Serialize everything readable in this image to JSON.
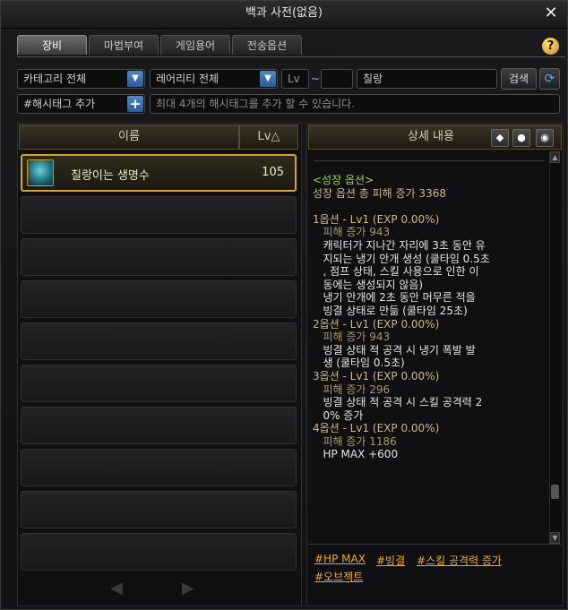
{
  "window": {
    "title": "백과 사전(없음)"
  },
  "tabs": [
    {
      "label": "장비",
      "active": true
    },
    {
      "label": "마법부여",
      "active": false
    },
    {
      "label": "게임용어",
      "active": false
    },
    {
      "label": "전송옵션",
      "active": false
    }
  ],
  "filters": {
    "category": "카테고리 전체",
    "rarity": "레어리티 전체",
    "lv_label": "Lv",
    "lv_sep": "~",
    "lv_from": "",
    "lv_to": "",
    "search_value": "칠랑",
    "search_button": "검색",
    "hashtag_button": "#해시태그 추가",
    "hashtag_placeholder": "최대 4개의 해시태그를 추가 할 수 있습니다."
  },
  "list": {
    "header_name": "이름",
    "header_lv": "Lv△",
    "items": [
      {
        "name": "칠랑이는 생명수",
        "level": "105",
        "selected": true,
        "icon": "potion-item-icon"
      }
    ],
    "empty_rows": 9,
    "prev": "◀",
    "next": "▶"
  },
  "detail": {
    "header": "상세 내용",
    "lines": [
      {
        "text": "<성장 옵션>",
        "style": "green"
      },
      {
        "text": "성장 옵션 총 피해 증가 3368",
        "style": "main"
      },
      {
        "text": "",
        "style": "main"
      },
      {
        "text": "1옵션 - Lv1 (EXP 0.00%)",
        "style": "main"
      },
      {
        "text": "   피해 증가 943",
        "style": "sub"
      },
      {
        "text": "   캐릭터가 지나간 자리에 3초 동안 유",
        "style": "white"
      },
      {
        "text": "   지되는 냉기 안개 생성 (쿨타임 0.5초",
        "style": "white"
      },
      {
        "text": "   , 점프 상태, 스킬 사용으로 인한 이",
        "style": "white"
      },
      {
        "text": "   동에는 생성되지 않음)",
        "style": "white"
      },
      {
        "text": "   냉기 안개에 2초 동안 머무른 적을",
        "style": "white"
      },
      {
        "text": "   빙결 상태로 만듦 (쿨타임 25초)",
        "style": "white"
      },
      {
        "text": "2옵션 - Lv1 (EXP 0.00%)",
        "style": "main"
      },
      {
        "text": "   피해 증가 943",
        "style": "sub"
      },
      {
        "text": "   빙결 상태 적 공격 시 냉기 폭발 발",
        "style": "white"
      },
      {
        "text": "   생 (쿨타임 0.5초)",
        "style": "white"
      },
      {
        "text": "3옵션 - Lv1 (EXP 0.00%)",
        "style": "main"
      },
      {
        "text": "   피해 증가 296",
        "style": "sub"
      },
      {
        "text": "   빙결 상태 적 공격 시 스킬 공격력 2",
        "style": "white"
      },
      {
        "text": "   0% 증가",
        "style": "white"
      },
      {
        "text": "4옵션 - Lv1 (EXP 0.00%)",
        "style": "main"
      },
      {
        "text": "   피해 증가 1186",
        "style": "sub"
      },
      {
        "text": "   HP MAX +600",
        "style": "white"
      }
    ],
    "hashtags": [
      "#HP MAX",
      "#빙결",
      "#스킬 공격력 증가",
      "#오브젝트"
    ]
  },
  "colors": {
    "accent_gold": "#d4a42a",
    "hashtag": "#f0a820",
    "button_blue": "#2b5c96"
  }
}
